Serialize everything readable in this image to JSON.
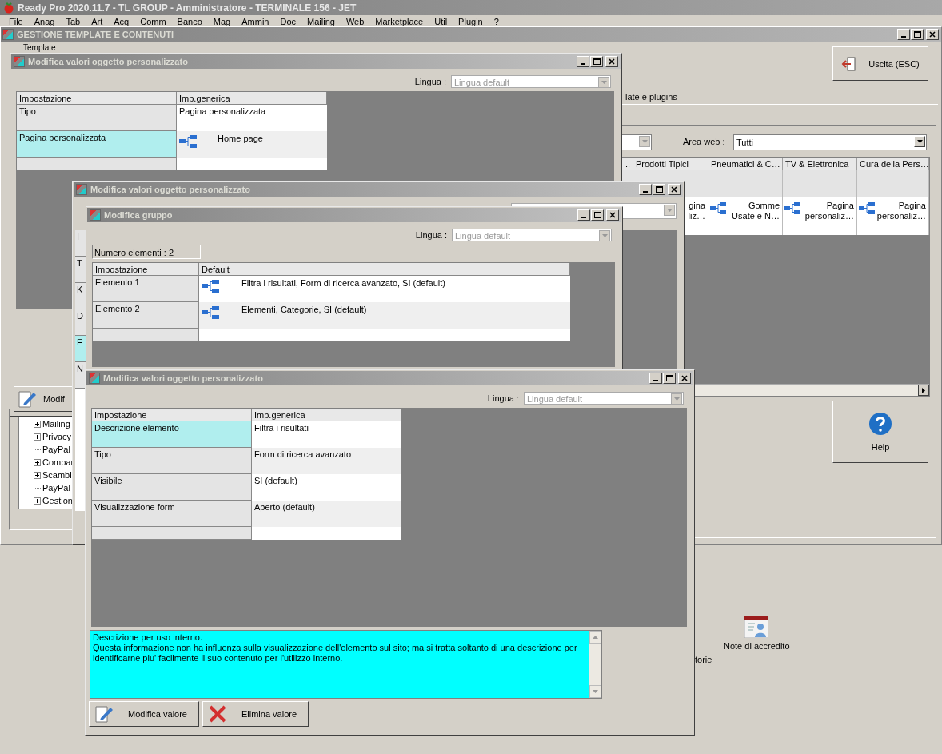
{
  "app": {
    "title": "Ready Pro 2020.11.7 - TL GROUP - Amministratore - TERMINALE 156 - JET",
    "menu": [
      "File",
      "Anag",
      "Tab",
      "Art",
      "Acq",
      "Comm",
      "Banco",
      "Mag",
      "Ammin",
      "Doc",
      "Mailing",
      "Web",
      "Marketplace",
      "Util",
      "Plugin",
      "?"
    ]
  },
  "main_window": {
    "title": "GESTIONE TEMPLATE E CONTENUTI",
    "group_label": "Template",
    "exit_button": "Uscita (ESC)",
    "tab": "late e plugins",
    "area_web": {
      "label": "Area web :",
      "value": "Tutti"
    },
    "grid": {
      "columns": [
        {
          "header": ".."
        },
        {
          "header": "Prodotti Tipici",
          "cell": "gina liz…"
        },
        {
          "header": "Pneumatici & C…",
          "cell": "Gomme Usate e N…"
        },
        {
          "header": "TV & Elettronica",
          "cell": "Pagina personaliz…"
        },
        {
          "header": "Cura della Pers…",
          "cell": "Pagina personaliz…"
        }
      ]
    },
    "help_button": "Help",
    "tree": [
      {
        "label": "Mailing",
        "kind": "collapsed"
      },
      {
        "label": "Privacy",
        "kind": "collapsed"
      },
      {
        "label": "PayPal",
        "kind": "leaf"
      },
      {
        "label": "Compar",
        "kind": "collapsed"
      },
      {
        "label": "Scambi",
        "kind": "collapsed"
      },
      {
        "label": "PayPal",
        "kind": "leaf"
      },
      {
        "label": "Gestion",
        "kind": "collapsed"
      }
    ]
  },
  "desktop": [
    {
      "label": "Note di accredito",
      "kind": "icon"
    },
    {
      "label": "torie",
      "kind": "text"
    }
  ],
  "windows": [
    {
      "kind": "editor",
      "title": "Modifica valori oggetto personalizzato",
      "language": {
        "label": "Lingua :",
        "value": "Lingua default"
      },
      "grid": {
        "columns": [
          "Impostazione",
          "Imp.generica"
        ],
        "rows": [
          {
            "label": "Tipo",
            "value": "Pagina personalizzata",
            "kind": "text",
            "selected": false
          },
          {
            "label": "Pagina personalizzata",
            "value": "Home page",
            "kind": "link",
            "selected": true
          }
        ]
      },
      "buttons": [
        {
          "label": "Modif",
          "kind": "edit"
        }
      ]
    },
    {
      "kind": "partial",
      "title": "Modifica valori oggetto personalizzato",
      "fragments": [
        {
          "text": "I",
          "selected": false
        },
        {
          "text": "T",
          "selected": false
        },
        {
          "text": "K",
          "selected": false
        },
        {
          "text": "D",
          "selected": false
        },
        {
          "text": "E",
          "selected": true
        },
        {
          "text": "N",
          "selected": false
        }
      ]
    },
    {
      "kind": "editor",
      "title": "Modifica gruppo",
      "language": {
        "label": "Lingua :",
        "value": "Lingua default"
      },
      "count": "Numero elementi : 2",
      "grid": {
        "columns": [
          "Impostazione",
          "Default"
        ],
        "rows": [
          {
            "label": "Elemento 1",
            "value": "Filtra i risultati, Form di ricerca avanzato, SI (default)",
            "kind": "link",
            "selected": false
          },
          {
            "label": "Elemento 2",
            "value": "Elementi, Categorie, SI (default)",
            "kind": "link",
            "selected": false
          }
        ]
      }
    },
    {
      "kind": "editor",
      "title": "Modifica valori oggetto personalizzato",
      "language": {
        "label": "Lingua :",
        "value": "Lingua default"
      },
      "grid": {
        "columns": [
          "Impostazione",
          "Imp.generica"
        ],
        "rows": [
          {
            "label": "Descrizione elemento",
            "value": "Filtra i risultati",
            "kind": "text",
            "selected": true
          },
          {
            "label": "Tipo",
            "value": "Form di ricerca avanzato",
            "kind": "text",
            "selected": false
          },
          {
            "label": "Visibile",
            "value": "SI (default)",
            "kind": "text",
            "selected": false
          },
          {
            "label": "Visualizzazione form",
            "value": "Aperto (default)",
            "kind": "text",
            "selected": false
          }
        ]
      },
      "description": [
        "Descrizione per uso interno.",
        "Questa informazione non ha influenza sulla visualizzazione dell'elemento sul sito; ma si tratta soltanto di una descrizione per identificarne piu' facilmente il suo contenuto per l'utilizzo interno."
      ],
      "buttons": [
        {
          "label": "Modifica valore",
          "kind": "edit"
        },
        {
          "label": "Elimina valore",
          "kind": "delete"
        }
      ]
    }
  ]
}
